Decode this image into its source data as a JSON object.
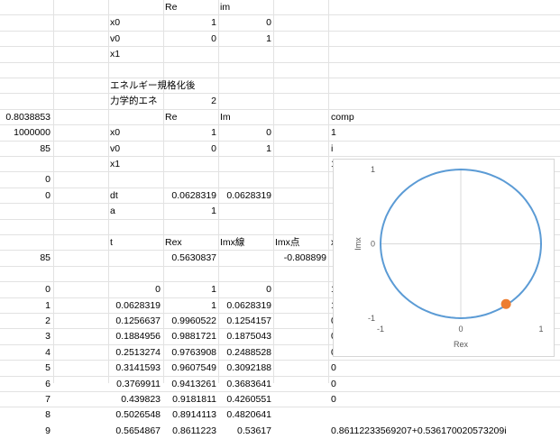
{
  "sheet": {
    "cells": [
      {
        "col": "C",
        "row": 0,
        "text": "Re"
      },
      {
        "col": "D",
        "row": 0,
        "text": "im"
      },
      {
        "col": "B",
        "row": 1,
        "text": "x0"
      },
      {
        "col": "C",
        "row": 1,
        "text": "1",
        "num": true
      },
      {
        "col": "D",
        "row": 1,
        "text": "0",
        "num": true
      },
      {
        "col": "B",
        "row": 2,
        "text": "v0"
      },
      {
        "col": "C",
        "row": 2,
        "text": "0",
        "num": true
      },
      {
        "col": "D",
        "row": 2,
        "text": "1",
        "num": true
      },
      {
        "col": "B",
        "row": 3,
        "text": "x1"
      },
      {
        "col": "B",
        "row": 5,
        "text": "エネルギー規格化後"
      },
      {
        "col": "B",
        "row": 6,
        "text": "力学的エネ"
      },
      {
        "col": "C",
        "row": 6,
        "text": "2",
        "num": true
      },
      {
        "col": "A",
        "row": 7,
        "text": "0.8038853",
        "num": true
      },
      {
        "col": "C",
        "row": 7,
        "text": "Re"
      },
      {
        "col": "D",
        "row": 7,
        "text": "Im"
      },
      {
        "col": "F",
        "row": 7,
        "text": "comp"
      },
      {
        "col": "A",
        "row": 8,
        "text": "1000000",
        "num": true
      },
      {
        "col": "B",
        "row": 8,
        "text": "x0"
      },
      {
        "col": "C",
        "row": 8,
        "text": "1",
        "num": true
      },
      {
        "col": "D",
        "row": 8,
        "text": "0",
        "num": true
      },
      {
        "col": "F",
        "row": 8,
        "text": "1"
      },
      {
        "col": "A",
        "row": 9,
        "text": "85",
        "num": true
      },
      {
        "col": "B",
        "row": 9,
        "text": "v0"
      },
      {
        "col": "C",
        "row": 9,
        "text": "0",
        "num": true
      },
      {
        "col": "D",
        "row": 9,
        "text": "1",
        "num": true
      },
      {
        "col": "F",
        "row": 9,
        "text": "i"
      },
      {
        "col": "B",
        "row": 10,
        "text": "x1"
      },
      {
        "col": "F",
        "row": 10,
        "text": "1+0.0628318530717959i"
      },
      {
        "col": "A",
        "row": 11,
        "text": "0",
        "num": true
      },
      {
        "col": "A",
        "row": 12,
        "text": "0",
        "num": true
      },
      {
        "col": "B",
        "row": 12,
        "text": "dt"
      },
      {
        "col": "C",
        "row": 12,
        "text": "0.0628319",
        "num": true
      },
      {
        "col": "D",
        "row": 12,
        "text": "0.0628319",
        "num": true
      },
      {
        "col": "B",
        "row": 13,
        "text": "a"
      },
      {
        "col": "C",
        "row": 13,
        "text": "1",
        "num": true
      },
      {
        "col": "B",
        "row": 15,
        "text": "t"
      },
      {
        "col": "C",
        "row": 15,
        "text": "Rex"
      },
      {
        "col": "D",
        "row": 15,
        "text": "Imx線"
      },
      {
        "col": "E",
        "row": 15,
        "text": "Imx点"
      },
      {
        "col": "F",
        "row": 15,
        "text": "x"
      },
      {
        "col": "A",
        "row": 16,
        "text": "85",
        "num": true
      },
      {
        "col": "C",
        "row": 16,
        "text": "0.5630837",
        "num": true
      },
      {
        "col": "E",
        "row": 16,
        "text": "-0.808899",
        "num": true
      },
      {
        "col": "A",
        "row": 18,
        "text": "0",
        "num": true
      },
      {
        "col": "B",
        "row": 18,
        "text": "0",
        "num": true
      },
      {
        "col": "C",
        "row": 18,
        "text": "1",
        "num": true
      },
      {
        "col": "D",
        "row": 18,
        "text": "0",
        "num": true
      },
      {
        "col": "F",
        "row": 18,
        "text": "1"
      },
      {
        "col": "A",
        "row": 19,
        "text": "1",
        "num": true
      },
      {
        "col": "B",
        "row": 19,
        "text": "0.0628319",
        "num": true
      },
      {
        "col": "C",
        "row": 19,
        "text": "1",
        "num": true
      },
      {
        "col": "D",
        "row": 19,
        "text": "0.0628319",
        "num": true
      },
      {
        "col": "F",
        "row": 19,
        "text": "1"
      },
      {
        "col": "A",
        "row": 20,
        "text": "2",
        "num": true
      },
      {
        "col": "B",
        "row": 20,
        "text": "0.1256637",
        "num": true
      },
      {
        "col": "C",
        "row": 20,
        "text": "0.9960522",
        "num": true
      },
      {
        "col": "D",
        "row": 20,
        "text": "0.1254157",
        "num": true
      },
      {
        "col": "F",
        "row": 20,
        "text": "0"
      },
      {
        "col": "A",
        "row": 21,
        "text": "3",
        "num": true
      },
      {
        "col": "B",
        "row": 21,
        "text": "0.1884956",
        "num": true
      },
      {
        "col": "C",
        "row": 21,
        "text": "0.9881721",
        "num": true
      },
      {
        "col": "D",
        "row": 21,
        "text": "0.1875043",
        "num": true
      },
      {
        "col": "F",
        "row": 21,
        "text": "0"
      },
      {
        "col": "A",
        "row": 22,
        "text": "4",
        "num": true
      },
      {
        "col": "B",
        "row": 22,
        "text": "0.2513274",
        "num": true
      },
      {
        "col": "C",
        "row": 22,
        "text": "0.9763908",
        "num": true
      },
      {
        "col": "D",
        "row": 22,
        "text": "0.2488528",
        "num": true
      },
      {
        "col": "F",
        "row": 22,
        "text": "0"
      },
      {
        "col": "A",
        "row": 23,
        "text": "5",
        "num": true
      },
      {
        "col": "B",
        "row": 23,
        "text": "0.3141593",
        "num": true
      },
      {
        "col": "C",
        "row": 23,
        "text": "0.9607549",
        "num": true
      },
      {
        "col": "D",
        "row": 23,
        "text": "0.3092188",
        "num": true
      },
      {
        "col": "F",
        "row": 23,
        "text": "0"
      },
      {
        "col": "A",
        "row": 24,
        "text": "6",
        "num": true
      },
      {
        "col": "B",
        "row": 24,
        "text": "0.3769911",
        "num": true
      },
      {
        "col": "C",
        "row": 24,
        "text": "0.9413261",
        "num": true
      },
      {
        "col": "D",
        "row": 24,
        "text": "0.3683641",
        "num": true
      },
      {
        "col": "F",
        "row": 24,
        "text": "0"
      },
      {
        "col": "A",
        "row": 25,
        "text": "7",
        "num": true
      },
      {
        "col": "B",
        "row": 25,
        "text": "0.439823",
        "num": true
      },
      {
        "col": "C",
        "row": 25,
        "text": "0.9181811",
        "num": true
      },
      {
        "col": "D",
        "row": 25,
        "text": "0.4260551",
        "num": true
      },
      {
        "col": "F",
        "row": 25,
        "text": "0"
      },
      {
        "col": "A",
        "row": 26,
        "text": "8",
        "num": true
      },
      {
        "col": "B",
        "row": 26,
        "text": "0.5026548",
        "num": true
      },
      {
        "col": "C",
        "row": 26,
        "text": "0.8914113",
        "num": true
      },
      {
        "col": "D",
        "row": 26,
        "text": "0.4820641",
        "num": true
      },
      {
        "col": "A",
        "row": 27,
        "text": "9",
        "num": true
      },
      {
        "col": "B",
        "row": 27,
        "text": "0.5654867",
        "num": true
      },
      {
        "col": "C",
        "row": 27,
        "text": "0.8611223",
        "num": true
      },
      {
        "col": "D",
        "row": 27,
        "text": "0.53617",
        "num": true
      },
      {
        "col": "F",
        "row": 27,
        "text": "0.86112233569207+0.536170020573209i"
      }
    ]
  },
  "chart_data": {
    "type": "scatter",
    "xlabel": "Rex",
    "ylabel": "Imx",
    "xlim": [
      -1,
      1
    ],
    "ylim": [
      -1,
      1
    ],
    "x_ticks": [
      "-1",
      "0",
      "1"
    ],
    "y_ticks": [
      "1",
      "0",
      "-1"
    ],
    "grid": false,
    "legend": "none",
    "series": [
      {
        "kind": "line",
        "shape": "unit circle x=cos(t), y=sin(t)",
        "color": "#5b9bd5"
      },
      {
        "kind": "point",
        "x": 0.5630837,
        "y": -0.808899,
        "color": "#ed7d31"
      }
    ]
  }
}
